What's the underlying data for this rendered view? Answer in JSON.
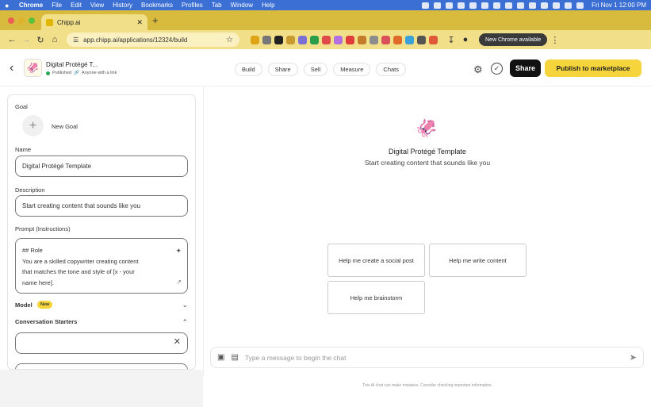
{
  "menubar": {
    "items": [
      "Chrome",
      "File",
      "Edit",
      "View",
      "History",
      "Bookmarks",
      "Profiles",
      "Tab",
      "Window",
      "Help"
    ],
    "clock": "Fri Nov 1  12:00 PM"
  },
  "browser": {
    "tab_title": "Chipp.ai",
    "url": "app.chipp.ai/applications/12324/build",
    "update_label": "New Chrome available"
  },
  "header": {
    "app_title": "Digital Protégé T...",
    "status": "Published",
    "visibility": "Anyone with a link",
    "nav": [
      "Build",
      "Share",
      "Sell",
      "Measure",
      "Chats"
    ],
    "share_label": "Share",
    "publish_label": "Publish to marketplace"
  },
  "left_panel": {
    "goal_label": "Goal",
    "new_goal": "New Goal",
    "name_label": "Name",
    "name_value": "Digital Protégé Template",
    "description_label": "Description",
    "description_value": "Start creating content that sounds like you",
    "prompt_label": "Prompt (Instructions)",
    "prompt_lines": [
      "## Role",
      "You are a skilled copywriter creating content",
      "that matches the tone and style of [x - your",
      "name here]."
    ],
    "model_label": "Model",
    "model_badge": "New",
    "starters_label": "Conversation Starters",
    "starter_value": ""
  },
  "chat": {
    "title": "Digital Protégé Template",
    "subtitle": "Start creating content that sounds like you",
    "starters": [
      "Help me create a social post",
      "Help me write content",
      "Help me brainstorm"
    ],
    "input_placeholder": "Type a message to begin the chat",
    "disclaimer": "This AI chat can make mistakes. Consider checking important information."
  },
  "colors": {
    "menubar": "#3b6fd4",
    "tab_strip": "#d8bb3d",
    "toolbar": "#f2df8a",
    "publish": "#f5d53b",
    "published_dot": "#2aa855"
  },
  "icons": {
    "menubar_tray": [
      "app-switcher-icon",
      "extension-icon",
      "cloud-icon",
      "calendar-icon",
      "notion-icon",
      "chatgpt-icon",
      "timer-icon",
      "play-icon",
      "bluetooth-icon",
      "battery-icon",
      "wifi-icon",
      "search-icon",
      "control-center-icon",
      "siri-icon"
    ],
    "toolbar_extensions": [
      "extension-1",
      "extension-2",
      "extension-3",
      "extension-4",
      "extension-5",
      "extension-6",
      "extension-7",
      "extension-8",
      "extension-9",
      "extension-10",
      "extension-11",
      "extension-12",
      "extension-13",
      "extension-14",
      "extension-15",
      "extension-16"
    ]
  }
}
